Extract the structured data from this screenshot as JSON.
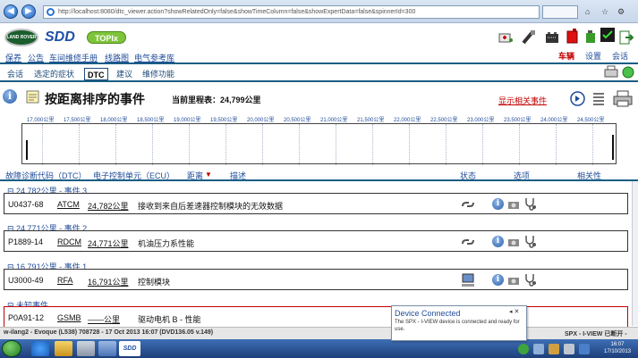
{
  "browser": {
    "url": "http://localhost:8080/dtc_viewer.action?showRelatedOnly=false&showTimeColumn=false&showExpertData=false&spinnerId=300",
    "search_placeholder": "",
    "toolbar_glyphs": [
      "⌂",
      "☆",
      "⚙"
    ]
  },
  "header": {
    "brand_badge": "LAND ROVER",
    "sdd_logo": "SDD",
    "topix_label": "TOPIx",
    "nav": [
      "保养",
      "公告",
      "车间维修手册",
      "线路图",
      "电气参考库"
    ],
    "right_tabs": [
      {
        "label": "车辆",
        "active": true
      },
      {
        "label": "设置",
        "active": false
      },
      {
        "label": "会话",
        "active": false
      }
    ]
  },
  "subnav": {
    "tabs": [
      {
        "label": "会话",
        "active": false
      },
      {
        "label": "选定的症状",
        "active": false
      },
      {
        "label": "DTC",
        "active": true
      },
      {
        "label": "建议",
        "active": false
      },
      {
        "label": "维修功能",
        "active": false
      }
    ]
  },
  "page": {
    "title": "按距离排序的事件",
    "odometer_label": "当前里程表：24,799公里",
    "show_related_link": "显示相关事件"
  },
  "timeline": {
    "labels": [
      "17,000公里",
      "17,500公里",
      "18,000公里",
      "18,500公里",
      "19,000公里",
      "19,500公里",
      "20,000公里",
      "20,500公里",
      "21,000公里",
      "21,500公里",
      "22,000公里",
      "22,500公里",
      "23,000公里",
      "23,500公里",
      "24,000公里",
      "24,500公里"
    ]
  },
  "table": {
    "headers": {
      "code": "故障诊断代码（DTC）",
      "ecu": "电子控制单元（ECU）",
      "distance": "距离",
      "sort_arrow": "▼",
      "description": "描述",
      "status": "状态",
      "options": "选项",
      "relevance": "相关性"
    }
  },
  "events": [
    {
      "group": "⊟ 24,782公里 - 事件 3",
      "code": "U0437-68",
      "ecu": "ATCM",
      "distance": "24,782公里",
      "description": "接收到来自后差速器控制模块的无效数据",
      "status_icon": "link-icon",
      "red": false
    },
    {
      "group": "⊟ 24,771公里 - 事件 2",
      "code": "P1889-14",
      "ecu": "RDCM",
      "distance": "24,771公里",
      "description": "机油压力系性能",
      "status_icon": "link-icon",
      "red": false
    },
    {
      "group": "⊟ 16,791公里 - 事件 1",
      "code": "U3000-49",
      "ecu": "RFA",
      "distance": "16,791公里",
      "description": "控制模块",
      "status_icon": "computer-icon",
      "red": false
    },
    {
      "group": "⊟ 未知事件",
      "code": "P0A91-12",
      "ecu": "GSMB",
      "distance": "——公里",
      "description": "驱动电机 B - 性能",
      "status_icon": "",
      "red": true
    }
  ],
  "statusbar": {
    "left": "w-ilang2 - Evoque (L538) 708728 - 17 Oct 2013 16:07 (DVD136.05 v.149)",
    "right": "SPX - I-VIEW 已断开 -"
  },
  "popup": {
    "title": "Device Connected",
    "body": "The SPX - I-VIEW device is connected and ready for use.",
    "controls": "◂ ✕"
  },
  "taskbar": {
    "sdd_button": "SDD",
    "clock_time": "16:07",
    "clock_date": "17/10/2013"
  },
  "colors": {
    "accent_blue": "#1f4c9a",
    "nav_line": "#1b5e85",
    "alert_red": "#c00000"
  }
}
